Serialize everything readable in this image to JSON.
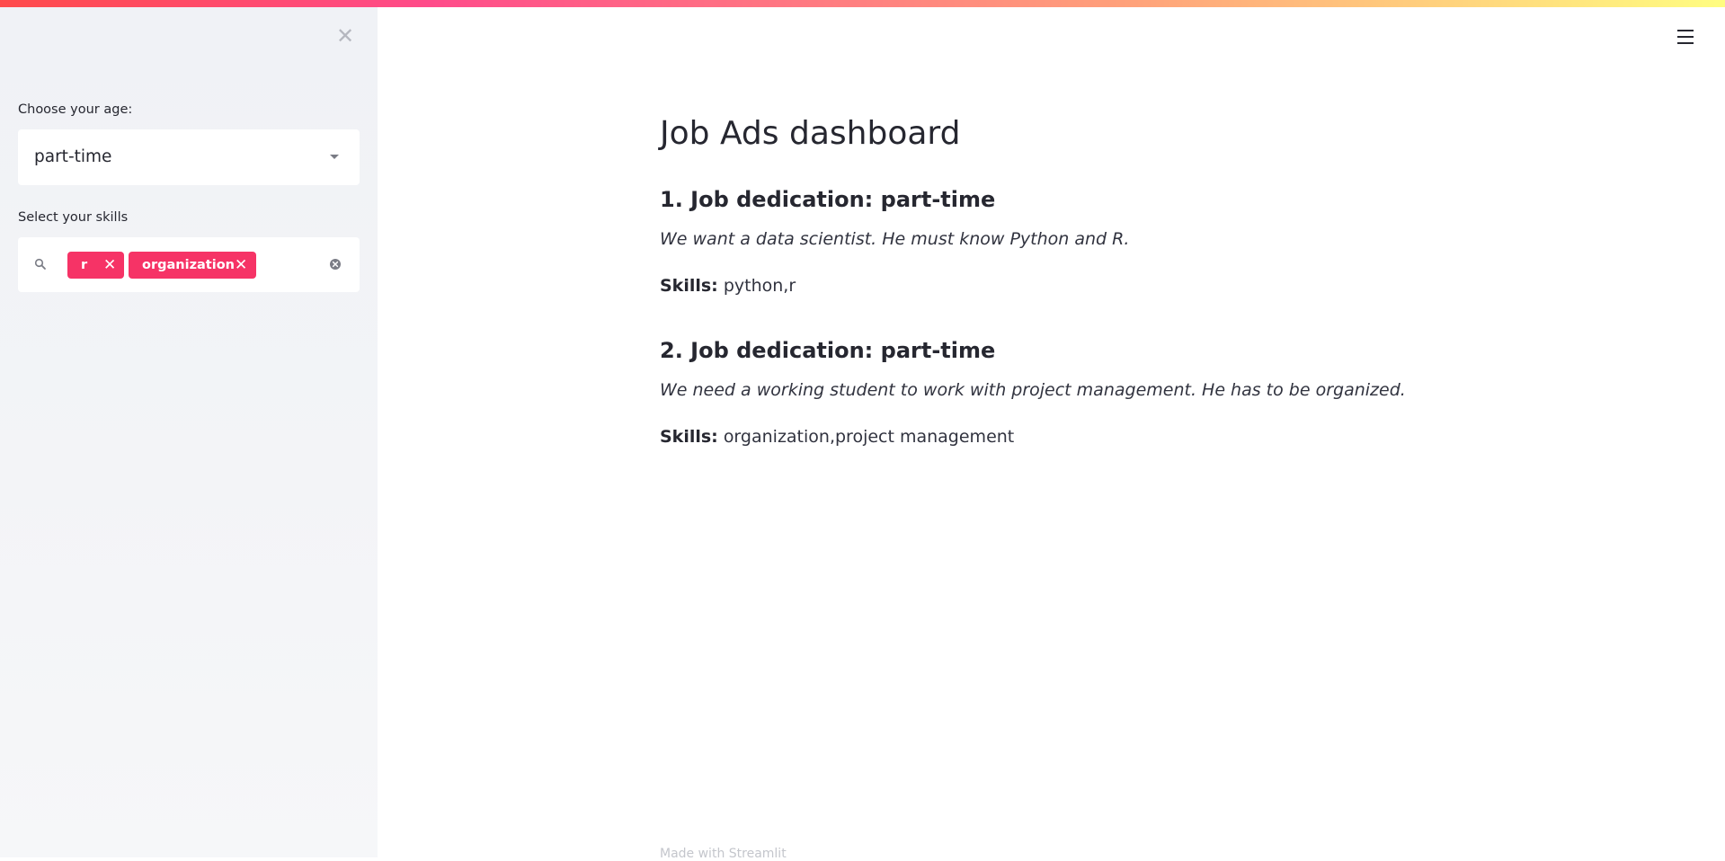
{
  "sidebar": {
    "age_label": "Choose your age:",
    "age_select": {
      "value": "part-time"
    },
    "skills_label": "Select your skills",
    "skills_tags": [
      {
        "label": "r"
      },
      {
        "label": "organization"
      }
    ]
  },
  "main": {
    "title": "Job Ads dashboard",
    "jobs": [
      {
        "heading": "1. Job dedication: part-time",
        "description": "We want a data scientist. He must know Python and R.",
        "skills_label": "Skills:",
        "skills": "python,r"
      },
      {
        "heading": "2. Job dedication: part-time",
        "description": "We need a working student to work with project management. He has to be organized.",
        "skills_label": "Skills:",
        "skills": "organization,project management"
      }
    ]
  },
  "footer": {
    "text": "Made with Streamlit"
  },
  "colors": {
    "accent": "#f63366",
    "sidebar_bg": "#f0f2f6",
    "text": "#262730"
  },
  "icons": {
    "close": "close-icon",
    "menu": "hamburger-menu-icon",
    "search": "search-icon",
    "dropdown": "chevron-down-icon",
    "clear": "clear-circle-icon",
    "tag_remove": "x-icon"
  }
}
